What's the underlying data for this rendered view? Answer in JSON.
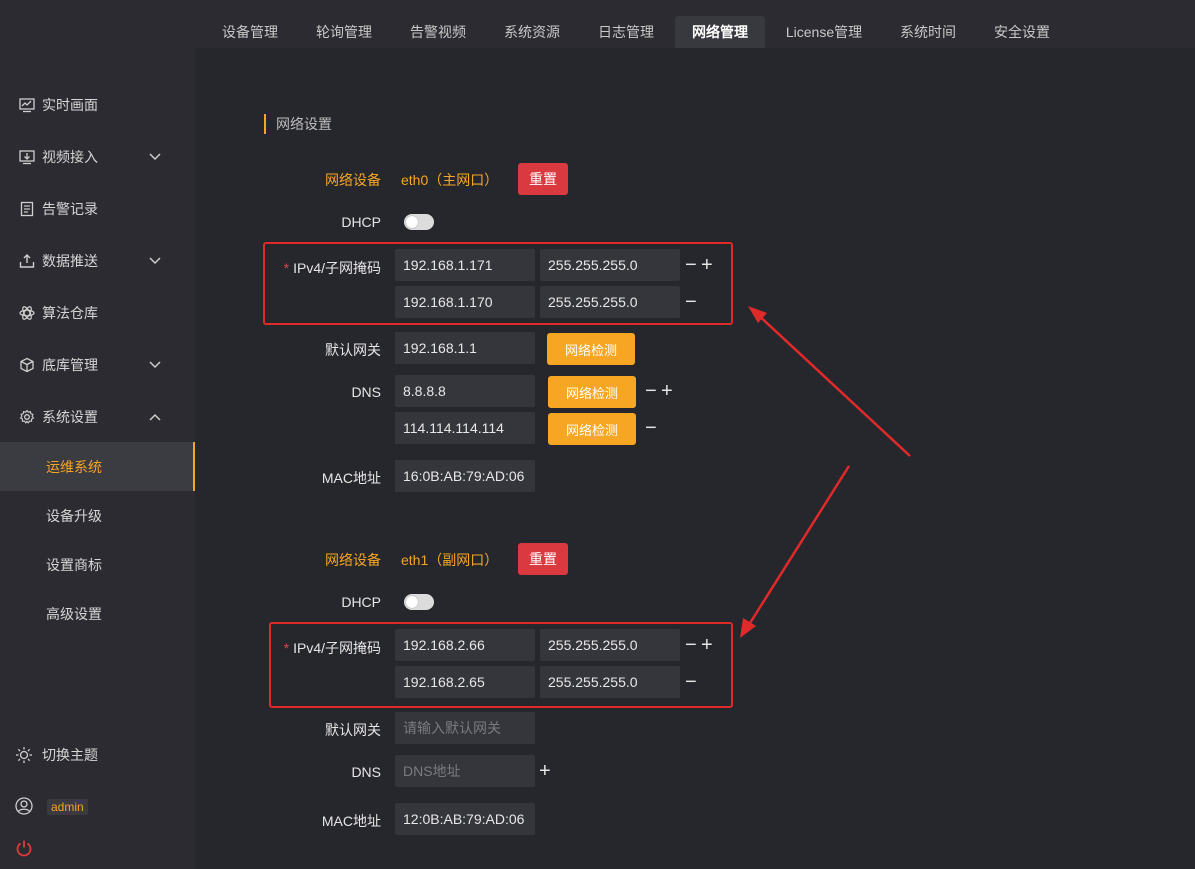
{
  "sidebar": {
    "items": [
      {
        "label": "实时画面",
        "icon": "monitor-chart-icon"
      },
      {
        "label": "视频接入",
        "icon": "video-input-icon",
        "expandable": true
      },
      {
        "label": "告警记录",
        "icon": "list-doc-icon"
      },
      {
        "label": "数据推送",
        "icon": "push-icon",
        "expandable": true
      },
      {
        "label": "算法仓库",
        "icon": "atom-icon"
      },
      {
        "label": "底库管理",
        "icon": "cube-icon",
        "expandable": true
      },
      {
        "label": "系统设置",
        "icon": "gear-icon",
        "expanded": true
      }
    ],
    "subitems": [
      {
        "label": "运维系统",
        "active": true
      },
      {
        "label": "设备升级"
      },
      {
        "label": "设置商标"
      },
      {
        "label": "高级设置"
      }
    ],
    "theme_label": "切换主题",
    "user": "admin"
  },
  "tabs": [
    {
      "label": "设备管理"
    },
    {
      "label": "轮询管理"
    },
    {
      "label": "告警视频"
    },
    {
      "label": "系统资源"
    },
    {
      "label": "日志管理"
    },
    {
      "label": "网络管理",
      "active": true
    },
    {
      "label": "License管理"
    },
    {
      "label": "系统时间"
    },
    {
      "label": "安全设置"
    }
  ],
  "main": {
    "section_title": "网络设置",
    "labels": {
      "device": "网络设备",
      "dhcp": "DHCP",
      "ipv4": "IPv4/子网掩码",
      "gateway": "默认网关",
      "dns": "DNS",
      "mac": "MAC地址",
      "reset": "重置",
      "check": "网络检测",
      "required_mark": "*"
    },
    "eth0": {
      "name": "eth0（主网口）",
      "dhcp_on": false,
      "ipv4": [
        {
          "ip": "192.168.1.171",
          "mask": "255.255.255.0"
        },
        {
          "ip": "192.168.1.170",
          "mask": "255.255.255.0"
        }
      ],
      "gateway": "192.168.1.1",
      "dns": [
        "8.8.8.8",
        "114.114.114.114"
      ],
      "mac": "16:0B:AB:79:AD:06"
    },
    "eth1": {
      "name": "eth1（副网口）",
      "dhcp_on": false,
      "ipv4": [
        {
          "ip": "192.168.2.66",
          "mask": "255.255.255.0"
        },
        {
          "ip": "192.168.2.65",
          "mask": "255.255.255.0"
        }
      ],
      "gateway_placeholder": "请输入默认网关",
      "dns_placeholder": "DNS地址",
      "mac": "12:0B:AB:79:AD:06"
    }
  },
  "colors": {
    "accent": "#f6a623",
    "danger": "#d9393f",
    "annotation": "#e02a2a",
    "background": "#26262d",
    "sidebar": "#2b2b31"
  }
}
